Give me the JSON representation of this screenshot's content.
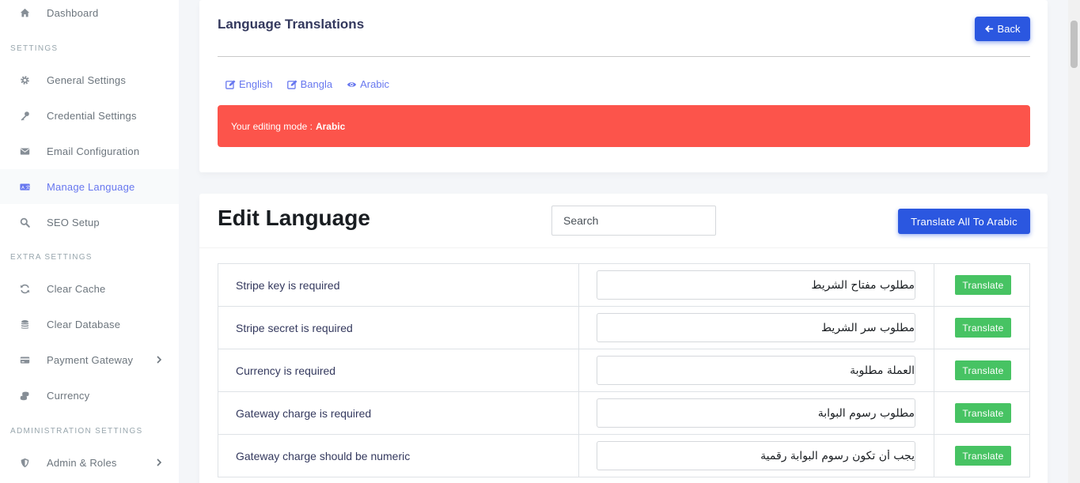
{
  "sidebar": {
    "dashboard": "Dashboard",
    "section_settings": "SETTINGS",
    "general_settings": "General Settings",
    "credential_settings": "Credential Settings",
    "email_configuration": "Email Configuration",
    "manage_language": "Manage Language",
    "seo_setup": "SEO Setup",
    "section_extra": "EXTRA SETTINGS",
    "clear_cache": "Clear Cache",
    "clear_database": "Clear Database",
    "payment_gateway": "Payment Gateway",
    "currency": "Currency",
    "section_admin": "ADMINISTRATION SETTINGS",
    "admin_roles": "Admin & Roles"
  },
  "translations_card": {
    "title": "Language Translations",
    "back_label": "Back",
    "languages": [
      "English",
      "Bangla",
      "Arabic"
    ],
    "alert_prefix": "Your editing mode :",
    "alert_language": "Arabic"
  },
  "edit_card": {
    "title": "Edit Language",
    "search_placeholder": "Search",
    "translate_all_label": "Translate All To Arabic",
    "translate_label": "Translate",
    "rows": [
      {
        "key": "Stripe key is required",
        "value": "مطلوب مفتاح الشريط"
      },
      {
        "key": "Stripe secret is required",
        "value": "مطلوب سر الشريط"
      },
      {
        "key": "Currency is required",
        "value": "العملة مطلوبة"
      },
      {
        "key": "Gateway charge is required",
        "value": "مطلوب رسوم البوابة"
      },
      {
        "key": "Gateway charge should be numeric",
        "value": "يجب أن تكون رسوم البوابة رقمية"
      }
    ]
  },
  "colors": {
    "primary": "#2b57e0",
    "accent": "#6777ef",
    "danger": "#fc544b",
    "success": "#47c363"
  }
}
